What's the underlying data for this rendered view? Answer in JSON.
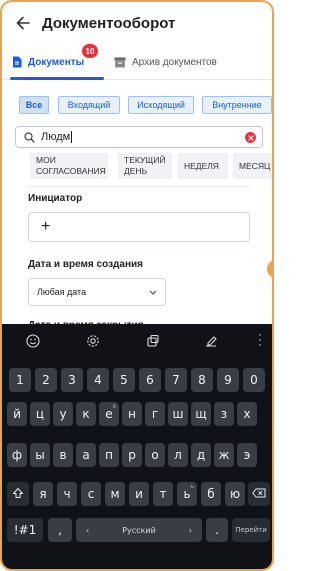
{
  "header": {
    "title": "Документооборот",
    "back_icon": "arrow-left-icon"
  },
  "tabs": [
    {
      "label": "Документы",
      "icon": "document-icon",
      "active": true,
      "badge": "10"
    },
    {
      "label": "Архив документов",
      "icon": "archive-icon",
      "active": false
    }
  ],
  "filters": [
    "Все",
    "Входящий",
    "Исходящий",
    "Внутренние"
  ],
  "search": {
    "value": "Людм",
    "icon": "search-icon",
    "clear_icon": "clear-icon"
  },
  "periods": [
    "МОИ СОГЛАСОВАНИЯ",
    "ТЕКУЩИЙ ДЕНЬ",
    "НЕДЕЛЯ",
    "МЕСЯЦ"
  ],
  "initiator": {
    "label": "Инициатор",
    "add": "+"
  },
  "created": {
    "label": "Дата и время создания",
    "value": "Любая дата"
  },
  "closed": {
    "label": "Дата и время закрытия"
  },
  "colors": {
    "accent": "#1a5fcf",
    "badge": "#e4343a",
    "frame": "#f0a24a",
    "keyboard_bg": "#101217",
    "key": "#3a3d44"
  },
  "keyboard": {
    "toolbar": [
      "emoji-icon",
      "settings-icon",
      "clipboard-icon",
      "handwriting-icon",
      "more-icon"
    ],
    "row_numbers": [
      "1",
      "2",
      "3",
      "4",
      "5",
      "6",
      "7",
      "8",
      "9",
      "0"
    ],
    "row1": [
      "й",
      "ц",
      "у",
      "к",
      "е",
      "н",
      "г",
      "ш",
      "щ",
      "з",
      "х"
    ],
    "row1_sup": [
      "",
      "",
      "",
      "",
      "ё",
      "",
      "",
      "",
      "",
      "",
      ""
    ],
    "row2": [
      "ф",
      "ы",
      "в",
      "а",
      "п",
      "р",
      "о",
      "л",
      "д",
      "ж",
      "э"
    ],
    "row3": [
      "я",
      "ч",
      "с",
      "м",
      "и",
      "т",
      "ь",
      "б",
      "ю"
    ],
    "row3_sup": [
      "",
      "",
      "",
      "",
      "",
      "",
      "ъ",
      "",
      ""
    ],
    "bottom": {
      "sym": "!#1",
      "comma": ",",
      "left": "‹",
      "space": "Русский",
      "right": "›",
      "dot": ".",
      "send": "Перейти"
    }
  }
}
